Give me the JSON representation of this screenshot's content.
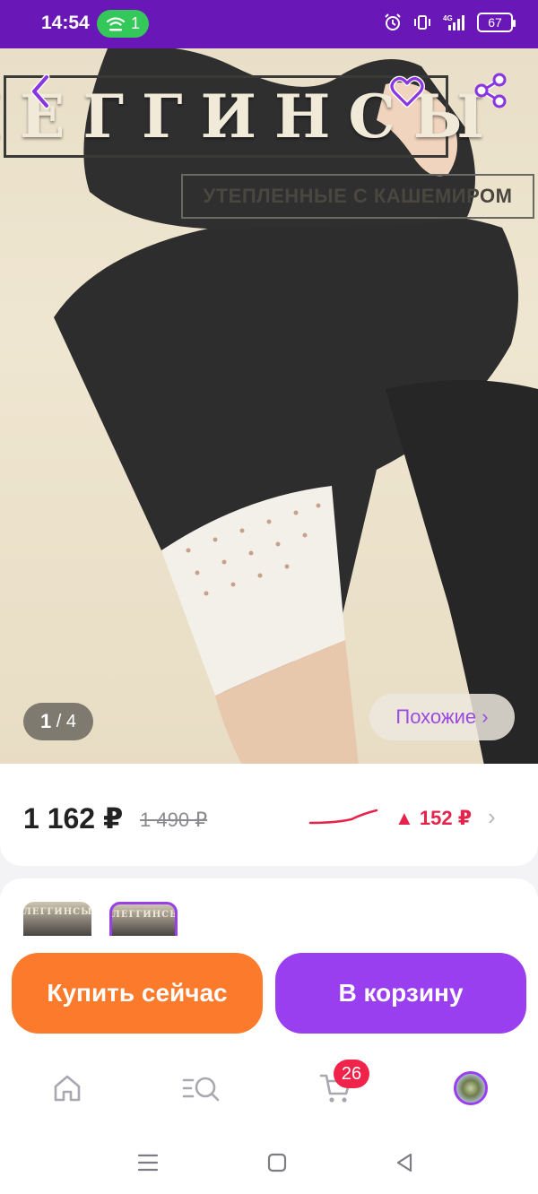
{
  "status_bar": {
    "time": "14:54",
    "hotspot_count": "1",
    "battery": "67",
    "network": "4G"
  },
  "hero": {
    "title": "ЛЕГГИНСЫ",
    "subtitle": "УТЕПЛЕННЫЕ С КАШЕМИРОМ",
    "counter_current": "1",
    "counter_total": "/ 4",
    "similar_label": "Похожие ›"
  },
  "price": {
    "current": "1 162 ₽",
    "old": "1 490 ₽",
    "change": "▲ 152 ₽",
    "chevron": "›"
  },
  "thumbnails": [
    {
      "label": "ЛЕГГИНСЫ"
    },
    {
      "label": "ЛЕГГИНСЫ"
    }
  ],
  "actions": {
    "buy_now": "Купить сейчас",
    "add_to_cart": "В корзину"
  },
  "tabs": {
    "cart_badge": "26",
    "icons": [
      "home-icon",
      "catalog-search-icon",
      "cart-icon",
      "profile-avatar"
    ]
  },
  "colors": {
    "status_bar": "#6a17b8",
    "accent_purple": "#9a3ff0",
    "buy_orange": "#fb7a2b",
    "price_up_red": "#e6244b",
    "badge_red": "#f0234a"
  }
}
